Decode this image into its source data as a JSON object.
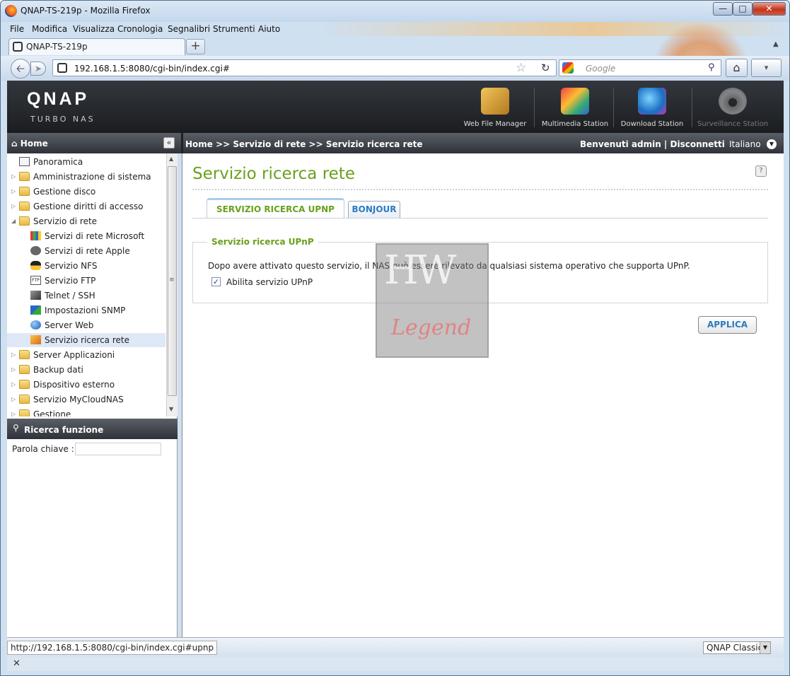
{
  "window": {
    "title": "QNAP-TS-219p - Mozilla Firefox"
  },
  "menu": [
    "File",
    "Modifica",
    "Visualizza",
    "Cronologia",
    "Segnalibri",
    "Strumenti",
    "Aiuto"
  ],
  "tab": {
    "title": "QNAP-TS-219p",
    "new_tab": "+"
  },
  "nav": {
    "url": "192.168.1.5:8080/cgi-bin/index.cgi#",
    "search_placeholder": "Google"
  },
  "qnap": {
    "logo": "QNAP",
    "subtitle": "TURBO NAS",
    "apps": [
      "Web File Manager",
      "Multimedia Station",
      "Download Station",
      "Surveillance Station"
    ]
  },
  "strip": {
    "home": "Home",
    "breadcrumb": "Home >> Servizio di rete >> Servizio ricerca rete",
    "welcome": "Benvenuti admin | Disconnetti",
    "language": "Italiano"
  },
  "tree": [
    {
      "label": "Panoramica"
    },
    {
      "label": "Amministrazione di sistema"
    },
    {
      "label": "Gestione disco"
    },
    {
      "label": "Gestione diritti di accesso"
    },
    {
      "label": "Servizio di rete"
    },
    {
      "label": "Servizi di rete Microsoft"
    },
    {
      "label": "Servizi di rete Apple"
    },
    {
      "label": "Servizio NFS"
    },
    {
      "label": "Servizio FTP"
    },
    {
      "label": "Telnet / SSH"
    },
    {
      "label": "Impostazioni SNMP"
    },
    {
      "label": "Server Web"
    },
    {
      "label": "Servizio ricerca rete"
    },
    {
      "label": "Server Applicazioni"
    },
    {
      "label": "Backup dati"
    },
    {
      "label": "Dispositivo esterno"
    },
    {
      "label": "Servizio MyCloudNAS"
    },
    {
      "label": "Gestione"
    }
  ],
  "search_panel": {
    "title": "Ricerca funzione",
    "keyword_label": "Parola chiave :"
  },
  "content": {
    "title": "Servizio ricerca rete",
    "tabs": [
      "SERVIZIO RICERCA UPNP",
      "BONJOUR"
    ],
    "legend": "Servizio ricerca UPnP",
    "description": "Dopo avere attivato questo servizio, il NAS può essere rilevato da qualsiasi sistema operativo che supporta UPnP.",
    "checkbox_label": "Abilita servizio UPnP",
    "checkbox_checked": true,
    "apply": "APPLICA"
  },
  "watermark": {
    "top": "HW",
    "bottom": "Legend"
  },
  "status": {
    "url": "http://192.168.1.5:8080/cgi-bin/index.cgi#upnp",
    "theme": "QNAP Classic"
  },
  "colors": {
    "accent_green": "#6aa01d",
    "link_blue": "#2a7cc2"
  }
}
